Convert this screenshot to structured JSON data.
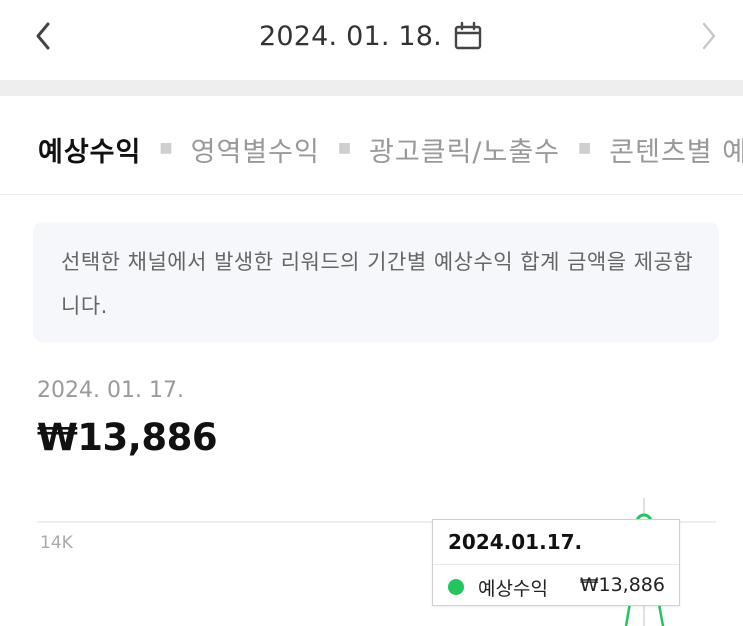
{
  "header": {
    "date": "2024. 01. 18.",
    "back_icon": "chevron-left-icon",
    "forward_icon": "chevron-right-icon",
    "calendar_icon": "calendar-icon"
  },
  "tabs": [
    {
      "label": "예상수익",
      "active": true
    },
    {
      "label": "영역별수익",
      "active": false
    },
    {
      "label": "광고클릭/노출수",
      "active": false
    },
    {
      "label": "콘텐츠별 예",
      "active": false
    }
  ],
  "info": {
    "text": "선택한 채널에서 발생한 리워드의 기간별 예상수익 합계 금액을 제공합니다."
  },
  "summary": {
    "date": "2024. 01. 17.",
    "amount": "₩13,886"
  },
  "chart_data": {
    "type": "line",
    "ytick_labels": [
      "14K"
    ],
    "series": [
      {
        "name": "예상수익",
        "color": "#22c55e",
        "highlight": {
          "date": "2024.01.17.",
          "value": 13886
        }
      }
    ]
  },
  "tooltip": {
    "date": "2024.01.17.",
    "series_label": "예상수익",
    "value": "₩13,886"
  },
  "colors": {
    "accent_green": "#22c55e",
    "band_gray": "#eeeeee",
    "info_bg": "#f6f7fa"
  }
}
